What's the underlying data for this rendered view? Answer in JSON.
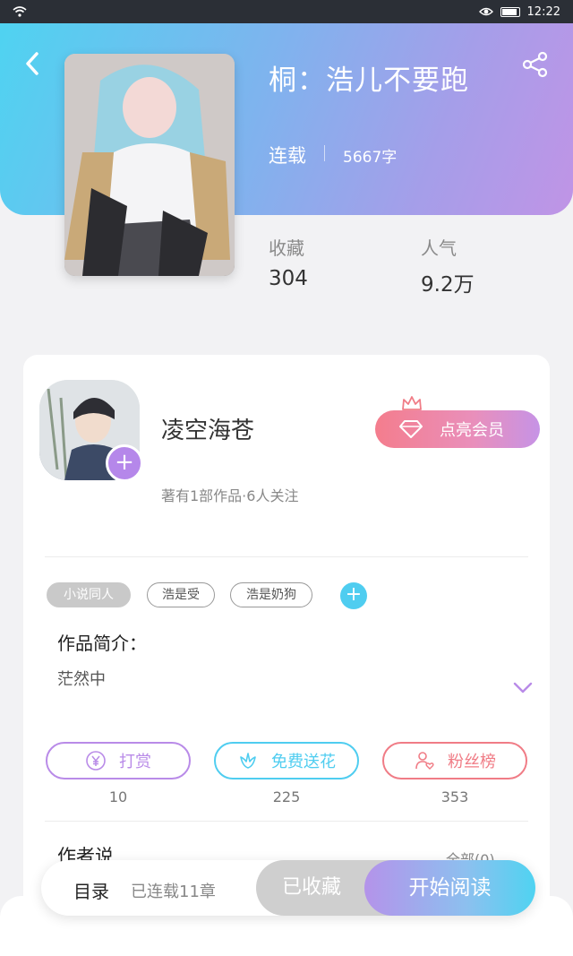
{
  "status": {
    "time": "12:22"
  },
  "book": {
    "title": "桐：浩儿不要跑",
    "serial_status": "连载",
    "word_count": "5667字",
    "stats": [
      {
        "label": "收藏",
        "value": "304"
      },
      {
        "label": "人气",
        "value": "9.2万"
      }
    ]
  },
  "author": {
    "name": "凌空海苍",
    "subtitle": "著有1部作品·6人关注",
    "vip_button": "点亮会员"
  },
  "tags": [
    "小说同人",
    "浩是受",
    "浩是奶狗"
  ],
  "intro": {
    "heading": "作品简介：",
    "text": "茫然中"
  },
  "actions": [
    {
      "label": "打赏",
      "count": "10",
      "color": "#b98be8",
      "icon": "yen-coin-icon"
    },
    {
      "label": "免费送花",
      "count": "225",
      "color": "#4fcdf0",
      "icon": "flower-icon"
    },
    {
      "label": "粉丝榜",
      "count": "353",
      "color": "#f07c86",
      "icon": "fan-person-icon"
    }
  ],
  "author_says": {
    "heading": "作者说",
    "all_label": "全部(0)"
  },
  "bottom_bar": {
    "toc_label": "目录",
    "toc_sub": "已连载11章",
    "favorited_label": "已收藏",
    "read_label": "开始阅读"
  }
}
